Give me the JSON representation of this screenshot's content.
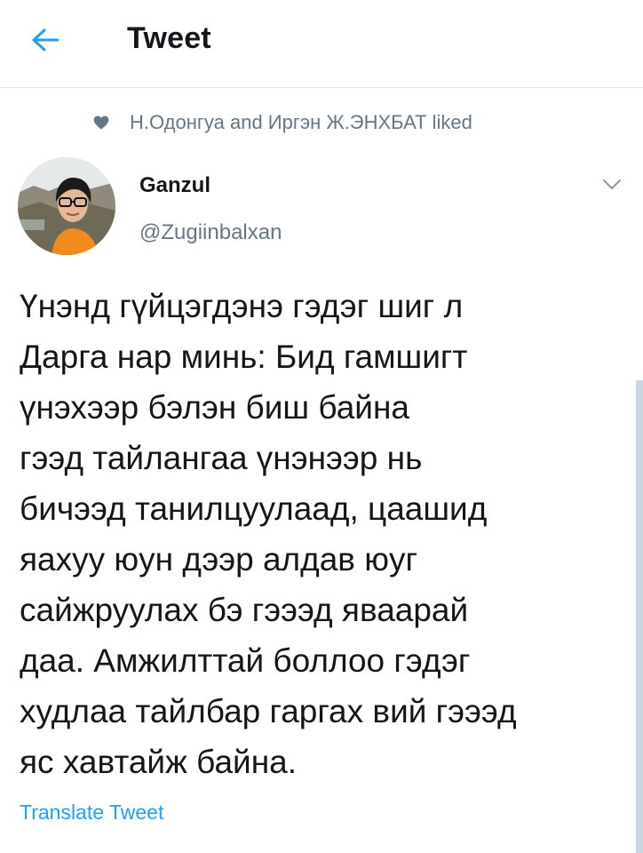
{
  "header": {
    "title": "Tweet",
    "back_icon": "arrow-left-icon",
    "accent_color": "#1da1f2"
  },
  "social_context": {
    "icon": "heart-icon",
    "text": "Н.Одонгуа and Иргэн Ж.ЭНХБАТ liked"
  },
  "tweet": {
    "author_name": "Ganzul",
    "author_handle": "@Zugiinbalxan",
    "text": "Үнэнд гүйцэгдэнэ гэдэг шиг л\nДарга нар минь: Бид гамшигт\nүнэхээр бэлэн биш байна\nгээд тайлангаа үнэнээр нь\nбичээд танилцуулаад, цаашид\nяахуу юун дээр алдав юуг\nсайжруулах бэ гэээд яваарай\nдаа. Амжилттай боллоо гэдэг\nхудлаа тайлбар гаргах вий гэээд\nяс хавтайж байна.",
    "translate_label": "Translate Tweet"
  }
}
